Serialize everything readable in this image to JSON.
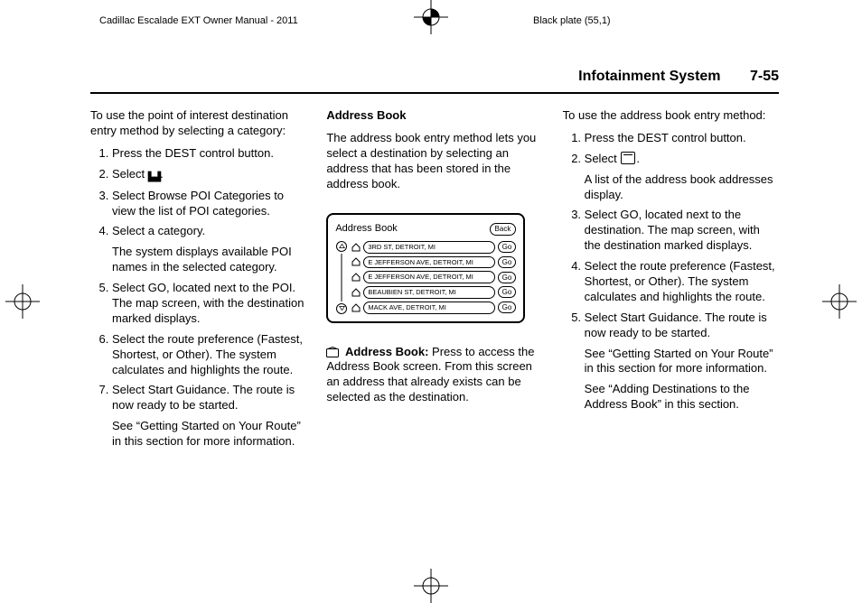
{
  "meta": {
    "doc_title": "Cadillac Escalade EXT Owner Manual - 2011",
    "plate": "Black plate (55,1)"
  },
  "running_head": {
    "section": "Infotainment System",
    "page": "7-55"
  },
  "col1": {
    "intro": "To use the point of interest destination entry method by selecting a category:",
    "s1": "Press the DEST control button.",
    "s2a": "Select ",
    "s2b": ".",
    "s3": "Select Browse POI Categories to view the list of POI categories.",
    "s4": "Select a category.",
    "s4sub": "The system displays available POI names in the selected category.",
    "s5": "Select GO, located next to the POI. The map screen, with the destination marked displays.",
    "s6": "Select the route preference (Fastest, Shortest, or Other). The system calculates and highlights the route.",
    "s7": "Select Start Guidance. The route is now ready to be started.",
    "s7sub": "See “Getting Started on Your Route” in this section for more information."
  },
  "col2": {
    "h": "Address Book",
    "p1": "The address book entry method lets you select a destination by selecting an address that has been stored in the address book.",
    "ill": {
      "title": "Address Book",
      "back": "Back",
      "go": "Go",
      "rows": [
        "3RD ST, DETROIT, MI",
        "E JEFFERSON AVE, DETROIT, MI",
        "E JEFFERSON AVE, DETROIT, MI",
        "BEAUBIEN ST, DETROIT, MI",
        "MACK AVE, DETROIT, MI"
      ]
    },
    "ab_label": "Address Book:",
    "ab_text": "  Press to access the Address Book screen. From this screen an address that already exists can be selected as the destination."
  },
  "col3": {
    "intro": "To use the address book entry method:",
    "s1": "Press the DEST control button.",
    "s2a": "Select ",
    "s2b": ".",
    "s2sub": "A list of the address book addresses display.",
    "s3": "Select GO, located next to the destination. The map screen, with the destination marked displays.",
    "s4": "Select the route preference (Fastest, Shortest, or Other). The system calculates and highlights the route.",
    "s5": "Select Start Guidance. The route is now ready to be started.",
    "s5sub1": "See “Getting Started on Your Route” in this section for more information.",
    "s5sub2": "See “Adding Destinations to the Address Book” in this section."
  }
}
